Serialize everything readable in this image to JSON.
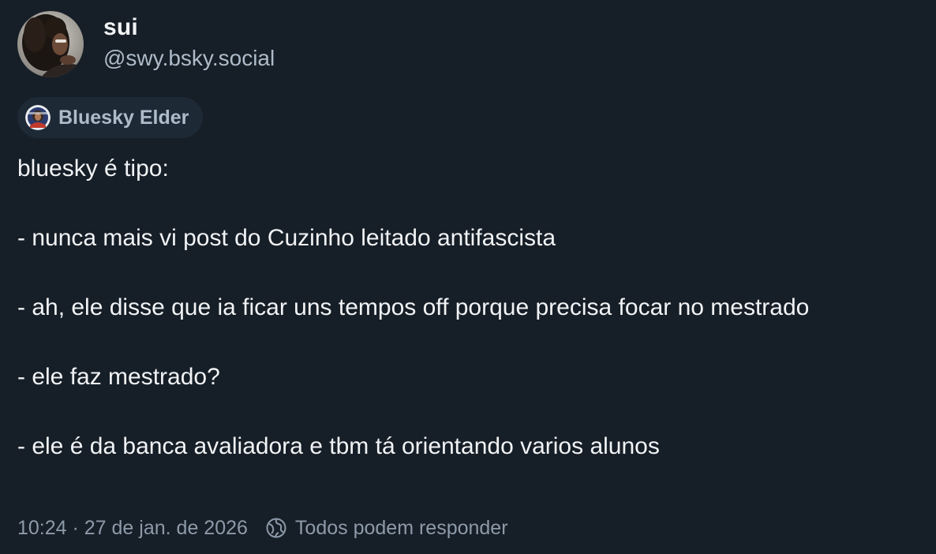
{
  "author": {
    "display_name": "sui",
    "handle": "@swy.bsky.social",
    "avatar_icon": "user-avatar"
  },
  "badge": {
    "label": "Bluesky Elder",
    "icon": "bluesky-elder-badge-icon"
  },
  "post": {
    "lines": [
      "bluesky é tipo:",
      "",
      "- nunca mais vi post do Cuzinho leitado antifascista",
      "",
      "- ah, ele disse que ia ficar uns tempos off porque precisa focar no mestrado",
      "",
      "- ele faz mestrado?",
      "",
      "- ele é da banca avaliadora e tbm tá orientando varios alunos"
    ]
  },
  "footer": {
    "timestamp": "10:24 · 27 de jan. de 2026",
    "reply_setting_icon": "globe-icon",
    "reply_setting": "Todos podem responder"
  },
  "colors": {
    "background": "#161e27",
    "text_primary": "#f1f3f5",
    "text_secondary": "#aebbc9",
    "text_meta": "#8d9aa9",
    "badge_bg": "#1e2936"
  }
}
